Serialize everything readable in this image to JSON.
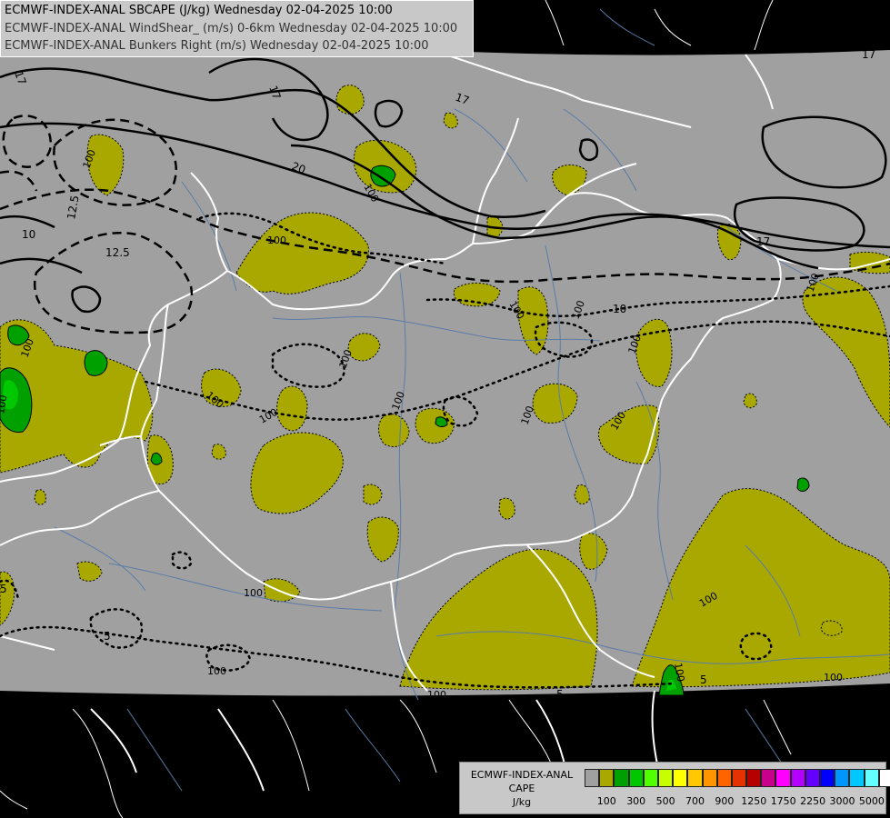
{
  "header": {
    "line1": "ECMWF-INDEX-ANAL SBCAPE (J/kg) Wednesday 02-04-2025 10:00",
    "line2": "ECMWF-INDEX-ANAL WindShear_ (m/s) 0-6km Wednesday 02-04-2025 10:00",
    "line3": "ECMWF-INDEX-ANAL Bunkers Right (m/s) Wednesday 02-04-2025 10:00"
  },
  "legend": {
    "title_line1": "ECMWF-INDEX-ANAL",
    "title_line2": "CAPE",
    "title_line3": "J/kg",
    "colors": [
      "#a0a0a0",
      "#a8a800",
      "#00a000",
      "#00c800",
      "#50ff00",
      "#c8ff00",
      "#ffff00",
      "#ffc800",
      "#ff9600",
      "#ff6400",
      "#e63200",
      "#b40000",
      "#c8008c",
      "#ff00ff",
      "#b400ff",
      "#6400ff",
      "#0000ff",
      "#0096ff",
      "#00c8ff",
      "#64ffff",
      "#ffffff"
    ],
    "ticks": [
      "100",
      "300",
      "500",
      "700",
      "900",
      "1250",
      "1750",
      "2250",
      "3000",
      "5000"
    ]
  },
  "map": {
    "colors": {
      "cape_100": "#a8a800",
      "cape_300": "#00a000",
      "cape_500": "#00c800",
      "background": "#a0a0a0",
      "outside": "#000000",
      "border": "#ffffff",
      "river": "#5a7ca8"
    },
    "labels": {
      "l17a": "17",
      "l17b": "17",
      "l17c": "17",
      "l17d": "17",
      "l20": "20",
      "l125a": "12.5",
      "l125b": "12.5",
      "l10a": "10",
      "l10b": "10",
      "l5a": "5",
      "l5b": "5",
      "l5c": "5",
      "l5d": "5",
      "c100a": "100",
      "c100b": "100",
      "c100c": "100",
      "c100d": "100",
      "c100e": "100",
      "c100f": "100",
      "c100g": "100",
      "c100h": "100",
      "c100i": "100",
      "c100j": "100",
      "c100k": "100",
      "c100l": "100",
      "c100m": "100",
      "c100n": "100",
      "c100o": "100",
      "c100p": "100",
      "c100q": "100",
      "c100r": "100"
    }
  }
}
